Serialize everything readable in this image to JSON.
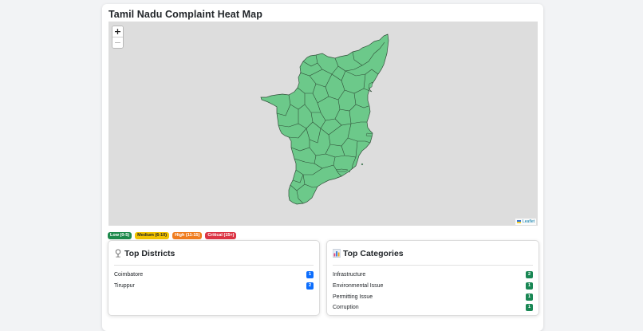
{
  "page": {
    "title": "Tamil Nadu Complaint Heat Map"
  },
  "map": {
    "zoom_in": "+",
    "zoom_out": "−",
    "attribution": "Leaflet",
    "region_color": "#6cc98a",
    "border_color": "#2f4f38",
    "background": "#dddddd"
  },
  "legend": [
    {
      "label": "Low (0-5)",
      "color": "#1e8a4c"
    },
    {
      "label": "Medium (6-10)",
      "color": "#f2c200",
      "text_color": "#212529"
    },
    {
      "label": "High (11-15)",
      "color": "#f07d1f"
    },
    {
      "label": "Critical (15+)",
      "color": "#dc3545"
    }
  ],
  "top_districts": {
    "title": "Top Districts",
    "icon": "map-pin-icon",
    "badge_color": "#0d6efd",
    "items": [
      {
        "name": "Coimbatore",
        "count": "1"
      },
      {
        "name": "Tiruppur",
        "count": "2"
      }
    ]
  },
  "top_categories": {
    "title": "Top Categories",
    "icon": "bar-chart-icon",
    "badge_color": "#198754",
    "items": [
      {
        "name": "Infrastructure",
        "count": "2"
      },
      {
        "name": "Environmental Issue",
        "count": "1"
      },
      {
        "name": "Permitting Issue",
        "count": "1"
      },
      {
        "name": "Corruption",
        "count": "1"
      }
    ]
  }
}
